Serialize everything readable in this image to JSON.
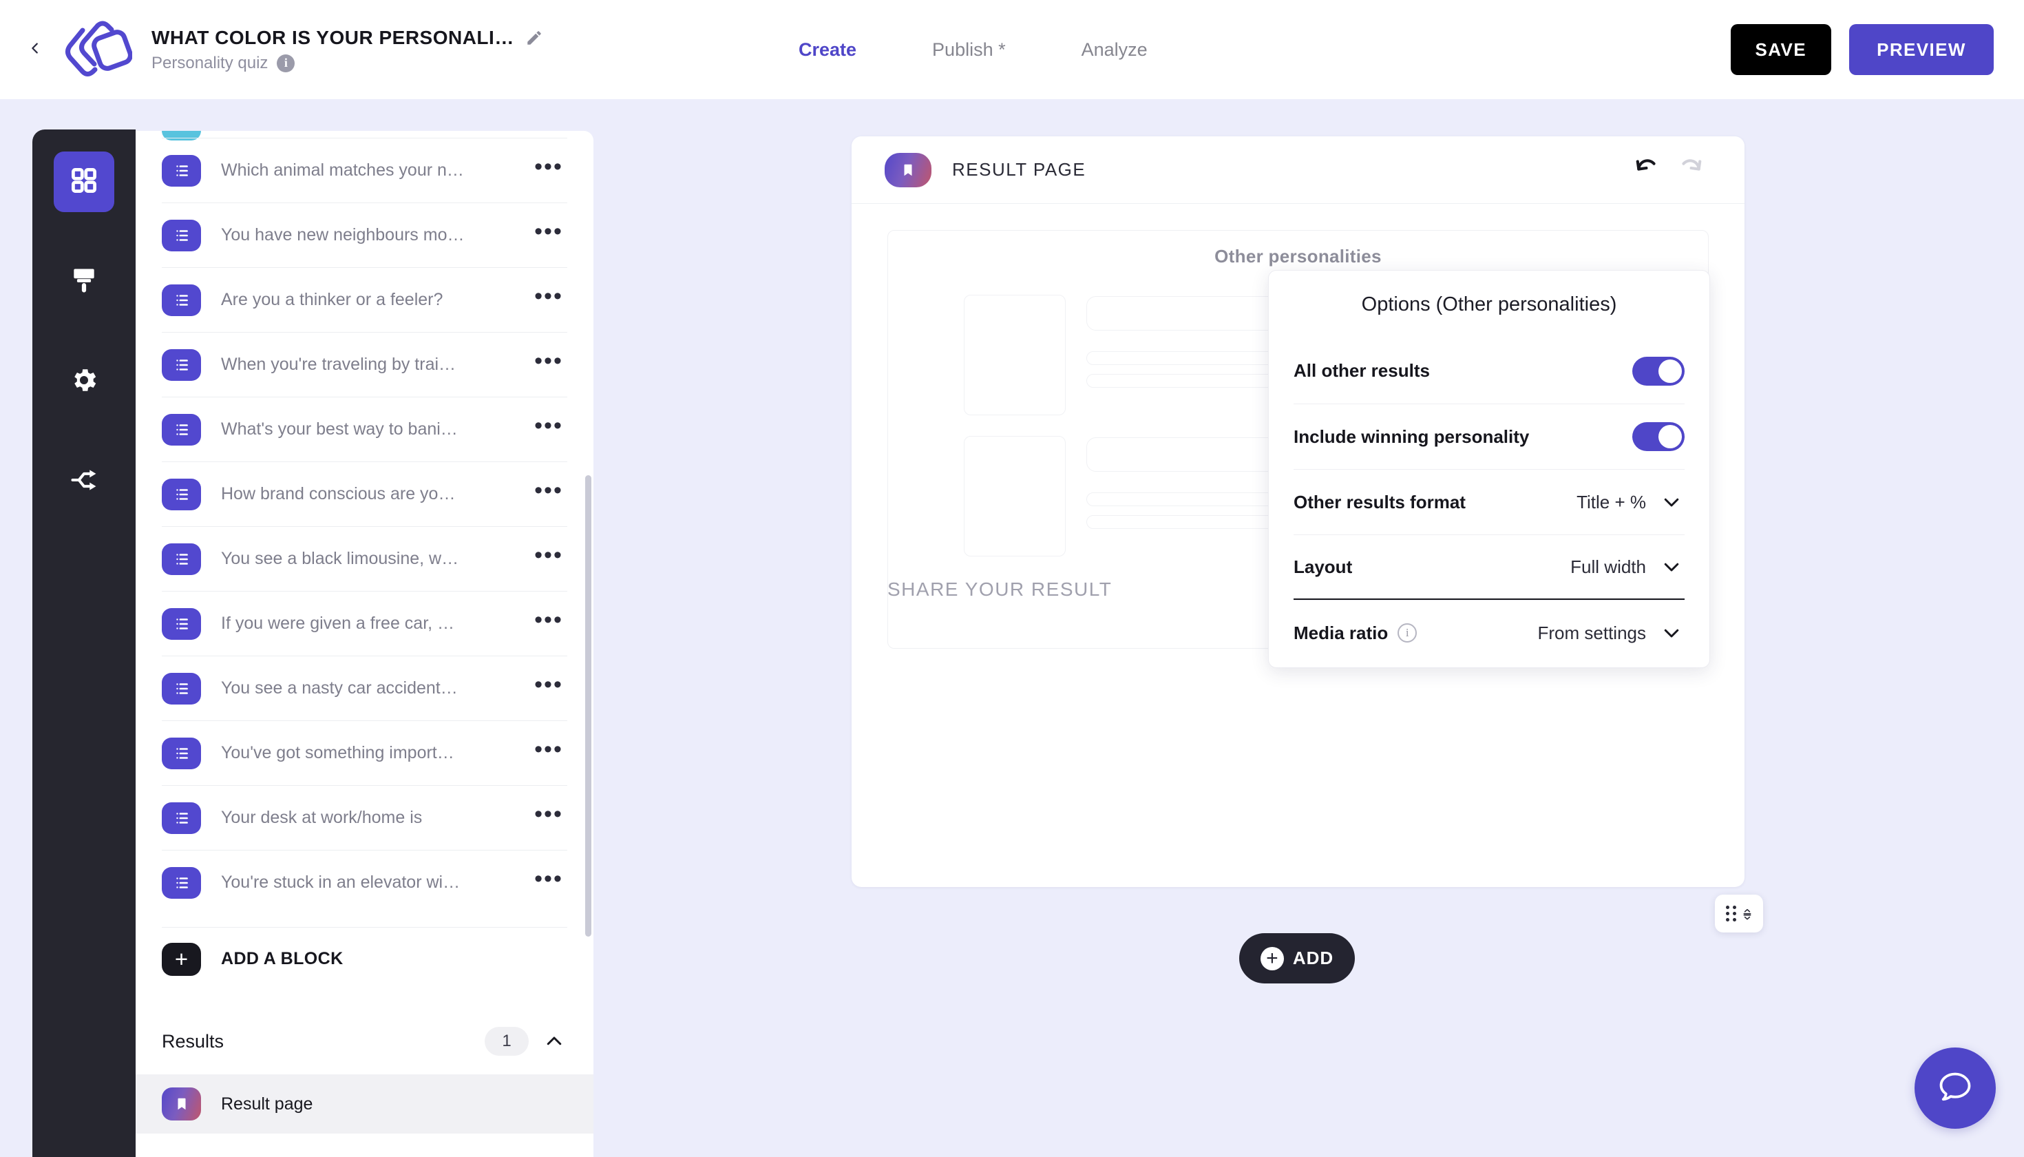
{
  "header": {
    "back_icon": "chevron-left-icon",
    "logo_icon": "brand-logo-icon",
    "quiz_title": "WHAT COLOR IS YOUR PERSONALI…",
    "edit_icon": "pencil-icon",
    "quiz_subtitle": "Personality quiz",
    "info_icon": "info-icon",
    "info_glyph": "i",
    "tabs": [
      {
        "label": "Create",
        "active": true
      },
      {
        "label": "Publish *",
        "active": false
      },
      {
        "label": "Analyze",
        "active": false
      }
    ],
    "save_label": "SAVE",
    "preview_label": "PREVIEW",
    "colors": {
      "accent": "#4f46c8",
      "save_bg": "#000000"
    }
  },
  "rail": {
    "items": [
      {
        "icon": "grid-icon",
        "active": true
      },
      {
        "icon": "paintbrush-icon",
        "active": false
      },
      {
        "icon": "gear-icon",
        "active": false
      },
      {
        "icon": "share-branch-icon",
        "active": false
      }
    ]
  },
  "panel": {
    "blocks": [
      {
        "label": "Which animal matches your n…"
      },
      {
        "label": "You have new neighbours mo…"
      },
      {
        "label": "Are you a thinker or a feeler?"
      },
      {
        "label": "When you're traveling by trai…"
      },
      {
        "label": "What's your best way to bani…"
      },
      {
        "label": "How brand conscious are yo…"
      },
      {
        "label": "You see a black limousine, w…"
      },
      {
        "label": "If you were given a free car, …"
      },
      {
        "label": "You see a nasty car accident…"
      },
      {
        "label": "You've got something import…"
      },
      {
        "label": "Your desk at work/home is"
      },
      {
        "label": "You're stuck in an elevator wi…"
      }
    ],
    "block_menu_glyph": "•••",
    "add_block_label": "ADD A BLOCK",
    "add_block_glyph": "+",
    "results_title": "Results",
    "results_count": "1",
    "results_collapse_icon": "chevron-up-icon",
    "result_item_label": "Result page",
    "result_item_icon": "bookmark-icon"
  },
  "canvas": {
    "page_icon": "bookmark-icon",
    "page_title": "RESULT PAGE",
    "undo_icon": "undo-icon",
    "redo_icon": "redo-icon",
    "skeleton_heading": "Other personalities",
    "share_label": "SHARE YOUR RESULT",
    "share_icons": [
      {
        "name": "facebook-icon"
      },
      {
        "name": "x-twitter-icon"
      },
      {
        "name": "whatsapp-icon"
      }
    ]
  },
  "options": {
    "title": "Options (Other personalities)",
    "rows": [
      {
        "label": "All other results",
        "type": "toggle",
        "value": "on"
      },
      {
        "label": "Include winning personality",
        "type": "toggle",
        "value": "on"
      },
      {
        "label": "Other results format",
        "type": "select",
        "value": "Title + %"
      },
      {
        "label": "Layout",
        "type": "select",
        "value": "Full width"
      },
      {
        "label": "Media ratio",
        "type": "select",
        "value": "From settings",
        "has_info": true
      }
    ],
    "info_glyph": "i",
    "chevron_icon": "chevron-down-icon"
  },
  "floating": {
    "drag_icon": "drag-dots-icon",
    "resize_icon": "resize-vertical-icon",
    "add_label": "ADD",
    "add_glyph": "+",
    "chat_icon": "chat-bubble-icon"
  }
}
